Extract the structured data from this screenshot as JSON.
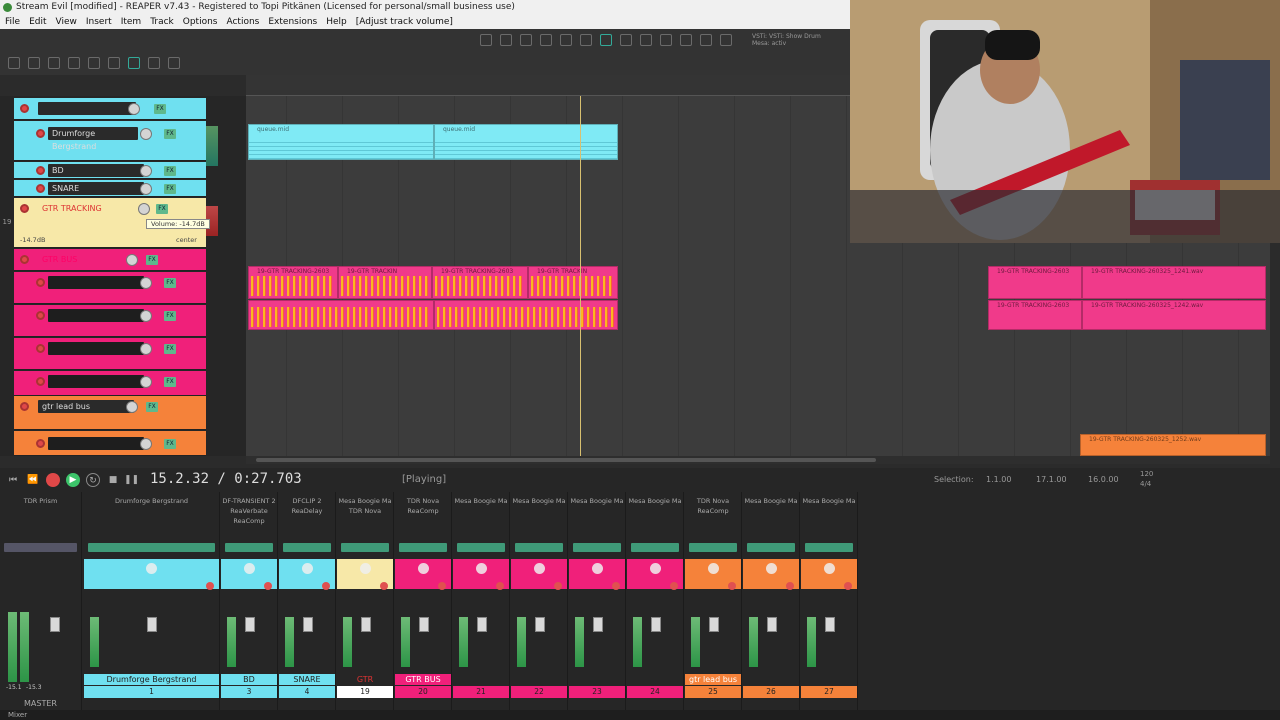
{
  "window": {
    "title": "Stream Evil [modified] - REAPER v7.43 - Registered to Topi Pitkänen (Licensed for personal/small business use)"
  },
  "menu": [
    "File",
    "Edit",
    "View",
    "Insert",
    "Item",
    "Track",
    "Options",
    "Actions",
    "Extensions",
    "Help",
    "[Adjust track volume]"
  ],
  "toolbar": {
    "vst_note": "VSTi: VSTi: Show Drum Mesa: activ"
  },
  "tracks": [
    {
      "name": "",
      "color": "#6fe0f0"
    },
    {
      "name": "Drumforge Bergstrand",
      "color": "#6fe0f0"
    },
    {
      "name": "BD",
      "color": "#6fe0f0"
    },
    {
      "name": "SNARE",
      "color": "#6fe0f0"
    },
    {
      "name": "GTR TRACKING",
      "color": "#f7e8a8",
      "volume": "-14.7dB",
      "pan": "center"
    },
    {
      "name": "GTR BUS",
      "color": "#f0207a"
    },
    {
      "name": "",
      "color": "#f0207a"
    },
    {
      "name": "",
      "color": "#f0207a"
    },
    {
      "name": "",
      "color": "#f0207a"
    },
    {
      "name": "",
      "color": "#f0207a"
    },
    {
      "name": "gtr lead bus",
      "color": "#f5823a"
    },
    {
      "name": "",
      "color": "#f5823a"
    }
  ],
  "track_numbers": [
    "",
    "",
    "",
    "",
    "19",
    "",
    "",
    "",
    "",
    "",
    "",
    "",
    "25"
  ],
  "tooltip": "Volume: -14.7dB",
  "items": {
    "midi1": "queue.mid",
    "midi2": "queue.mid",
    "gtr_labels": [
      "19-GTR TRACKING-2603",
      "19-GTR TRACKIN",
      "19-GTR TRACKING-2603",
      "19-GTR TRACKIN"
    ],
    "gtr_labels_right": [
      "19-GTR TRACKING-2603",
      "19-GTR TRACKING-260325_1241.wav",
      "19-GTR TRACKING-2603",
      "19-GTR TRACKING-260325_1242.wav"
    ],
    "bottom_label": "19-GTR TRACKING-260325_1252.wav"
  },
  "transport": {
    "position": "15.2.32 / 0:27.703",
    "state": "[Playing]",
    "selection_label": "Selection:",
    "sel_start": "1.1.00",
    "sel_end": "17.1.00",
    "sel_len": "16.0.00",
    "bpm": "120",
    "rate": "4/4"
  },
  "mixer": {
    "master_label": "MASTER",
    "master_db": [
      "-15.1",
      "-15.3"
    ],
    "footer": "Mixer",
    "strips": [
      {
        "top": "TDR Prism",
        "fx": "",
        "color": "#262626",
        "label": "",
        "num": "",
        "numcolor": "#262626"
      },
      {
        "top": "Drumforge Bergstrand",
        "fx": "",
        "color": "#6fe0f0",
        "label": "Drumforge Bergstrand",
        "num": "1",
        "numcolor": "#6fe0f0"
      },
      {
        "top": "DF-TRANSIENT 2 ReaVerbate ReaComp",
        "fx": "",
        "color": "#6fe0f0",
        "label": "BD",
        "num": "3",
        "numcolor": "#6fe0f0"
      },
      {
        "top": "DFCLIP 2 ReaDelay",
        "fx": "",
        "color": "#6fe0f0",
        "label": "SNARE",
        "num": "4",
        "numcolor": "#6fe0f0"
      },
      {
        "top": "Mesa Boogie Ma TDR Nova",
        "fx": "",
        "color": "#f7e8a8",
        "label": "GTR TRACKING",
        "num": "19",
        "numcolor": "#f7e8a8"
      },
      {
        "top": "TDR Nova ReaComp",
        "fx": "",
        "color": "#f0207a",
        "label": "GTR BUS",
        "num": "20",
        "numcolor": "#f0207a"
      },
      {
        "top": "Mesa Boogie Ma",
        "fx": "",
        "color": "#f0207a",
        "label": "",
        "num": "21",
        "numcolor": "#f0207a"
      },
      {
        "top": "Mesa Boogie Ma",
        "fx": "",
        "color": "#f0207a",
        "label": "",
        "num": "22",
        "numcolor": "#f0207a"
      },
      {
        "top": "Mesa Boogie Ma",
        "fx": "",
        "color": "#f0207a",
        "label": "",
        "num": "23",
        "numcolor": "#f0207a"
      },
      {
        "top": "Mesa Boogie Ma",
        "fx": "",
        "color": "#f0207a",
        "label": "",
        "num": "24",
        "numcolor": "#f0207a"
      },
      {
        "top": "TDR Nova ReaComp",
        "fx": "",
        "color": "#f5823a",
        "label": "gtr lead bus",
        "num": "25",
        "numcolor": "#f5823a"
      },
      {
        "top": "Mesa Boogie Ma",
        "fx": "",
        "color": "#f5823a",
        "label": "",
        "num": "26",
        "numcolor": "#f5823a"
      },
      {
        "top": "Mesa Boogie Ma",
        "fx": "",
        "color": "#f5823a",
        "label": "",
        "num": "27",
        "numcolor": "#f5823a"
      }
    ]
  }
}
